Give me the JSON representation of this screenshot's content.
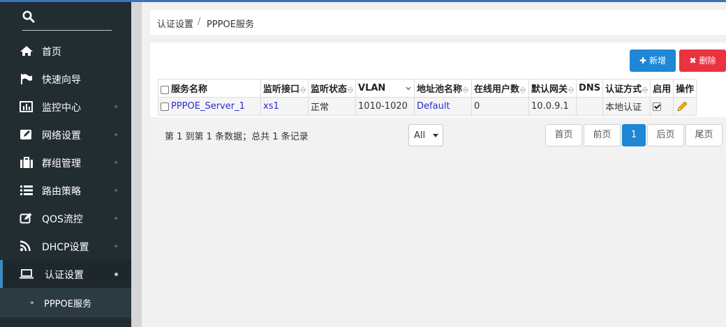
{
  "sidebar": {
    "items": [
      {
        "label": "首页",
        "icon": "home-icon"
      },
      {
        "label": "快速向导",
        "icon": "flag-icon"
      },
      {
        "label": "监控中心",
        "icon": "bar-chart-icon"
      },
      {
        "label": "网络设置",
        "icon": "edit-icon"
      },
      {
        "label": "群组管理",
        "icon": "briefcase-icon"
      },
      {
        "label": "路由策略",
        "icon": "list-icon"
      },
      {
        "label": "QOS流控",
        "icon": "pencil-square-icon"
      },
      {
        "label": "DHCP设置",
        "icon": "rss-icon"
      },
      {
        "label": "认证设置",
        "icon": "laptop-icon",
        "active": true
      }
    ],
    "sub_items": [
      {
        "label": "PPPOE服务"
      }
    ]
  },
  "breadcrumb": {
    "parent": "认证设置",
    "separator": "/",
    "current": "PPPOE服务"
  },
  "toolbar": {
    "add_label": "新增",
    "delete_label": "删除"
  },
  "table": {
    "headers": [
      "服务名称",
      "监听接口",
      "监听状态",
      "VLAN",
      "地址池名称",
      "在线用户数",
      "默认网关",
      "DNS",
      "认证方式",
      "启用",
      "操作"
    ],
    "rows": [
      {
        "name": "PPPOE_Server_1",
        "interface": "xs1",
        "status": "正常",
        "vlan": "1010-1020",
        "pool": "Default",
        "online": "0",
        "gateway": "10.0.9.1",
        "dns": "",
        "auth": "本地认证",
        "enabled": true
      }
    ]
  },
  "pagination": {
    "info": "第 1 到第 1 条数据；总共 1 条记录",
    "page_size": "All",
    "first": "首页",
    "prev": "前页",
    "current": "1",
    "next": "后页",
    "last": "尾页"
  },
  "colors": {
    "accent": "#1e87d6",
    "danger": "#e9343f",
    "sidebar": "#222d32",
    "link": "#2a2ad6"
  }
}
